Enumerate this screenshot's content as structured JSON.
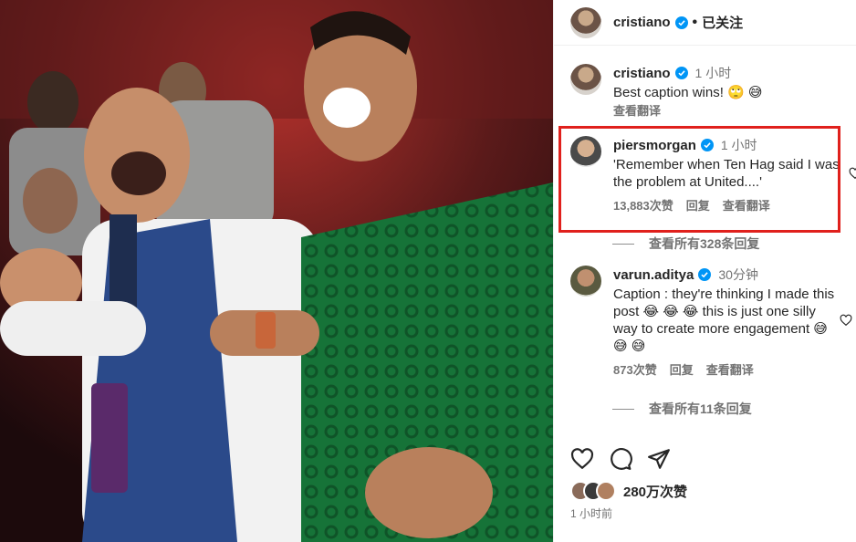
{
  "header": {
    "username": "cristiano",
    "follow_label": "已关注"
  },
  "comments": [
    {
      "username": "cristiano",
      "time": "1 小时",
      "text": "Best caption wins! 🙄 😅",
      "actions": [
        "查看翻译"
      ]
    },
    {
      "username": "piersmorgan",
      "time": "1 小时",
      "text": "'Remember when Ten Hag said I was the problem at United....'",
      "actions": [
        "13,883次赞",
        "回复",
        "查看翻译"
      ]
    },
    {
      "username": "varun.aditya",
      "time": "30分钟",
      "text": "Caption : they're thinking I made this post 😂 😂 😂 this is just one silly way to create more engagement 😅 😅 😅",
      "actions": [
        "873次赞",
        "回复",
        "查看翻译"
      ]
    }
  ],
  "view_replies": [
    "查看所有328条回复",
    "查看所有11条回复"
  ],
  "likes_label": "280万次赞",
  "post_time": "1 小时前",
  "colors": {
    "highlight": "#e0201c",
    "verified": "#0095f6",
    "jacket": "#1b7a3a"
  }
}
